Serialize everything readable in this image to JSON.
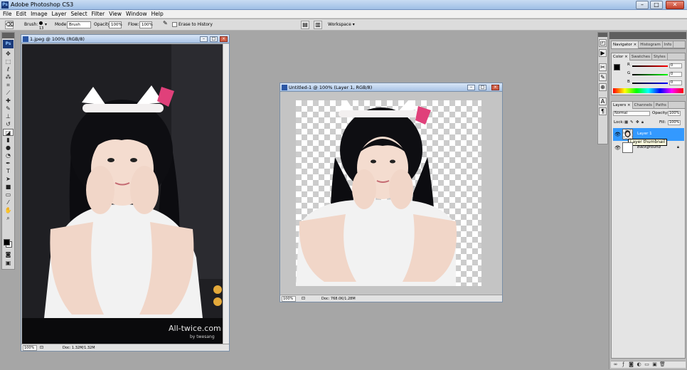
{
  "app": {
    "title": "Adobe Photoshop CS3",
    "logo": "Ps"
  },
  "window_controls": [
    "–",
    "□",
    "✕"
  ],
  "menu": [
    "File",
    "Edit",
    "Image",
    "Layer",
    "Select",
    "Filter",
    "View",
    "Window",
    "Help"
  ],
  "options": {
    "brush_label": "Brush:",
    "brush_size": "13",
    "mode_label": "Mode:",
    "mode_value": "Brush",
    "opacity_label": "Opacity:",
    "opacity_value": "100%",
    "flow_label": "Flow:",
    "flow_value": "100%",
    "erase_history_label": "Erase to History",
    "workspace_label": "Workspace ▾"
  },
  "toolbox": {
    "logo": "Ps",
    "tools": [
      "move-icon",
      "marquee-icon",
      "lasso-icon",
      "magic-wand-icon",
      "crop-icon",
      "slice-icon",
      "healing-icon",
      "brush-icon",
      "stamp-icon",
      "history-brush-icon",
      "eraser-icon",
      "gradient-icon",
      "blur-icon",
      "dodge-icon",
      "pen-icon",
      "type-icon",
      "path-select-icon",
      "shape-icon",
      "notes-icon",
      "eyedropper-icon",
      "hand-icon",
      "zoom-icon"
    ],
    "foreground_color": "#000000",
    "background_color": "#ffffff"
  },
  "doc_left": {
    "title": "1.jpeg @ 100% (RGB/8)",
    "zoom": "100%",
    "doc_info": "Doc: 1.32M/1.32M",
    "watermark": "All-twice.com",
    "watermark_sub": "by twesang"
  },
  "doc_right": {
    "title": "Untitled-1 @ 100% (Layer 1, RGB/8)",
    "zoom": "100%",
    "doc_info": "Doc: 768.0K/1.28M"
  },
  "panels": {
    "nav_tabs": [
      "Navigator ×",
      "Histogram",
      "Info"
    ],
    "color_tabs": [
      "Color ×",
      "Swatches",
      "Styles"
    ],
    "color": {
      "r_label": "R",
      "g_label": "G",
      "b_label": "B",
      "r_value": "0",
      "g_value": "0",
      "b_value": "0"
    },
    "layers_tabs": [
      "Layers ×",
      "Channels",
      "Paths"
    ],
    "layers": {
      "blend_mode": "Normal",
      "opacity_label": "Opacity:",
      "opacity_value": "100%",
      "lock_label": "Lock:",
      "fill_label": "Fill:",
      "fill_value": "100%",
      "items": [
        {
          "name": "Layer 1",
          "selected": true
        },
        {
          "name": "Background",
          "selected": false
        }
      ],
      "tooltip": "Layer thumbnail"
    }
  },
  "colors": {
    "selection_blue": "#3399ff",
    "titlebar": "#a9c3e6"
  }
}
